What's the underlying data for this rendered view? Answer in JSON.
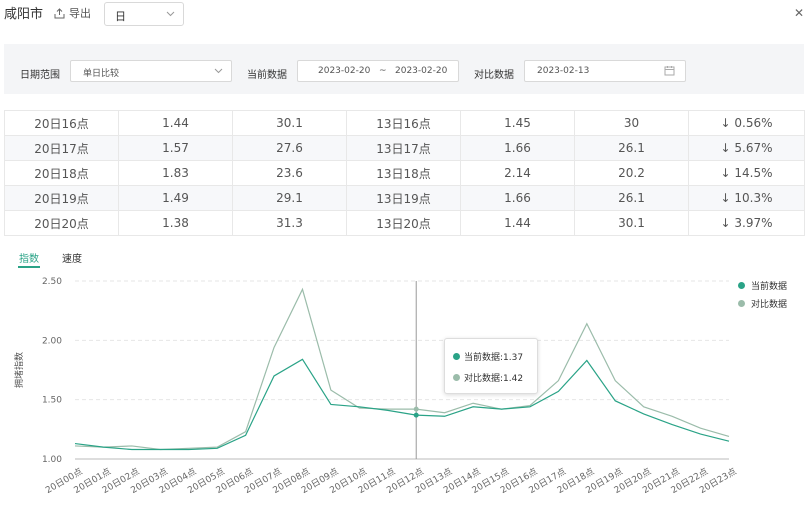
{
  "header": {
    "city": "咸阳市",
    "export_label": "导出",
    "granularity": "日"
  },
  "filter": {
    "date_range_label": "日期范围",
    "date_range_value": "单日比较",
    "current_label": "当前数据",
    "current_start": "2023-02-20",
    "range_sep": "~",
    "current_end": "2023-02-20",
    "compare_label": "对比数据",
    "compare_date": "2023-02-13"
  },
  "table": {
    "rows": [
      [
        "20日16点",
        "1.44",
        "30.1",
        "13日16点",
        "1.45",
        "30",
        "↓ 0.56%"
      ],
      [
        "20日17点",
        "1.57",
        "27.6",
        "13日17点",
        "1.66",
        "26.1",
        "↓ 5.67%"
      ],
      [
        "20日18点",
        "1.83",
        "23.6",
        "13日18点",
        "2.14",
        "20.2",
        "↓ 14.5%"
      ],
      [
        "20日19点",
        "1.49",
        "29.1",
        "13日19点",
        "1.66",
        "26.1",
        "↓ 10.3%"
      ],
      [
        "20日20点",
        "1.38",
        "31.3",
        "13日20点",
        "1.44",
        "30.1",
        "↓ 3.97%"
      ]
    ]
  },
  "tabs": [
    "指数",
    "速度"
  ],
  "tooltip": {
    "current": "当前数据:1.37",
    "compare": "对比数据:1.42"
  },
  "colors": {
    "current": "#2aa387",
    "compare": "#9bbcaa"
  },
  "chart_data": {
    "type": "line",
    "ylabel": "拥堵指数",
    "ylim": [
      1.0,
      2.5
    ],
    "yticks": [
      "1.00",
      "1.50",
      "2.00",
      "2.50"
    ],
    "categories": [
      "20日00点",
      "20日01点",
      "20日02点",
      "20日03点",
      "20日04点",
      "20日05点",
      "20日06点",
      "20日07点",
      "20日08点",
      "20日09点",
      "20日10点",
      "20日11点",
      "20日12点",
      "20日13点",
      "20日14点",
      "20日15点",
      "20日16点",
      "20日17点",
      "20日18点",
      "20日19点",
      "20日20点",
      "20日21点",
      "20日22点",
      "20日23点"
    ],
    "series": [
      {
        "name": "当前数据",
        "values": [
          1.13,
          1.1,
          1.08,
          1.08,
          1.08,
          1.09,
          1.2,
          1.7,
          1.84,
          1.46,
          1.44,
          1.41,
          1.37,
          1.36,
          1.44,
          1.42,
          1.44,
          1.57,
          1.83,
          1.49,
          1.38,
          1.29,
          1.21,
          1.15
        ]
      },
      {
        "name": "对比数据",
        "values": [
          1.11,
          1.1,
          1.11,
          1.08,
          1.09,
          1.1,
          1.23,
          1.94,
          2.43,
          1.58,
          1.43,
          1.42,
          1.42,
          1.39,
          1.47,
          1.42,
          1.45,
          1.66,
          2.14,
          1.66,
          1.44,
          1.36,
          1.26,
          1.19
        ]
      }
    ],
    "legend": "top-right"
  }
}
